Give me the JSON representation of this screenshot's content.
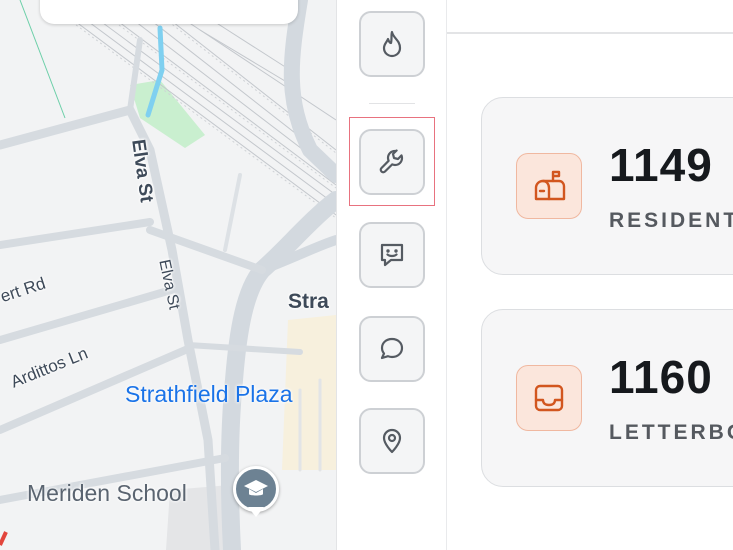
{
  "map": {
    "streets": {
      "elva_st_main": "Elva St",
      "elva_st_minor": "Elva St",
      "ert_rd": "ert Rd",
      "arditto_ln": "Ardittos Ln",
      "stra_partial": "Stra"
    },
    "places": {
      "plaza": "Strathfield Plaza",
      "school": "Meriden School"
    },
    "icons": {
      "school_pin": "school-icon"
    }
  },
  "toolbar": {
    "tools": [
      {
        "id": "fire",
        "icon": "flame-icon"
      },
      {
        "id": "wrench",
        "icon": "wrench-icon",
        "highlighted": true
      },
      {
        "id": "feedback",
        "icon": "smiley-chat-icon"
      },
      {
        "id": "chat",
        "icon": "chat-bubble-icon"
      },
      {
        "id": "location",
        "icon": "location-pin-icon"
      }
    ]
  },
  "stats": {
    "cards": [
      {
        "value": "1149",
        "label": "RESIDENTI",
        "icon": "mailbox-icon"
      },
      {
        "value": "1160",
        "label": "LETTERBOX",
        "icon": "inbox-tray-icon"
      }
    ]
  },
  "colors": {
    "accent_orange": "#d2561f",
    "icon_bg": "#fbe6dc",
    "highlight_border": "#e8727f",
    "poi_blue": "#1a73e8"
  }
}
